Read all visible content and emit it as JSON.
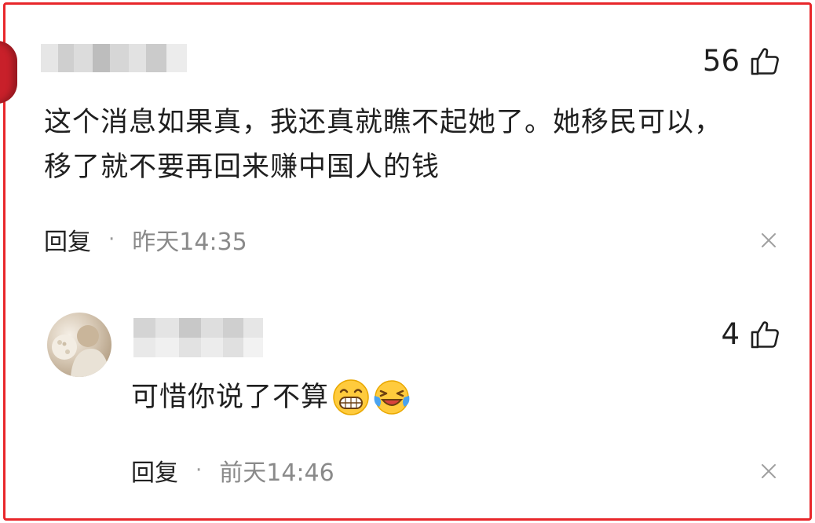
{
  "comments": [
    {
      "likes": "56",
      "text_line1": "这个消息如果真，我还真就瞧不起她了。她移民可以，",
      "text_line2": "移了就不要再回来赚中国人的钱",
      "reply_label": "回复",
      "separator": "·",
      "time": "昨天14:35"
    },
    {
      "likes": "4",
      "text": "可惜你说了不算",
      "emojis": [
        "grin-emoji",
        "laughing-crying-emoji"
      ],
      "reply_label": "回复",
      "separator": "·",
      "time": "前天14:46"
    }
  ],
  "colors": {
    "frame_border": "#e8262a",
    "text": "#1f1f1f",
    "muted": "#8a8a8a"
  }
}
